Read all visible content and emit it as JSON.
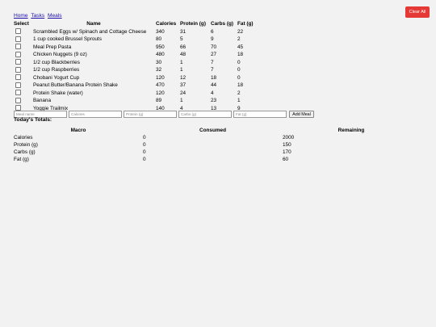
{
  "clear_all_label": "Clear All",
  "nav": {
    "home": "Home",
    "tasks": "Tasks",
    "meals": "Meals"
  },
  "meals_table": {
    "headers": {
      "select": "Select",
      "name": "Name",
      "calories": "Calories",
      "protein": "Protein (g)",
      "carbs": "Carbs (g)",
      "fat": "Fat (g)"
    },
    "rows": [
      {
        "name": "Scrambled Eggs w/ Spinach and Cottage Cheese",
        "calories": "340",
        "protein": "31",
        "carbs": "6",
        "fat": "22"
      },
      {
        "name": "1 cup cooked Brussel Sprouts",
        "calories": "80",
        "protein": "5",
        "carbs": "9",
        "fat": "2"
      },
      {
        "name": "Meal Prep Pasta",
        "calories": "950",
        "protein": "66",
        "carbs": "70",
        "fat": "45"
      },
      {
        "name": "Chicken Nuggets (9 oz)",
        "calories": "480",
        "protein": "48",
        "carbs": "27",
        "fat": "18"
      },
      {
        "name": "1/2 cup Blackberries",
        "calories": "30",
        "protein": "1",
        "carbs": "7",
        "fat": "0"
      },
      {
        "name": "1/2 cup Raspberries",
        "calories": "32",
        "protein": "1",
        "carbs": "7",
        "fat": "0"
      },
      {
        "name": "Chobani Yogurt Cup",
        "calories": "120",
        "protein": "12",
        "carbs": "18",
        "fat": "0"
      },
      {
        "name": "Peanut Butter/Banana Protein Shake",
        "calories": "470",
        "protein": "37",
        "carbs": "44",
        "fat": "18"
      },
      {
        "name": "Protein Shake (water)",
        "calories": "120",
        "protein": "24",
        "carbs": "4",
        "fat": "2"
      },
      {
        "name": "Banana",
        "calories": "89",
        "protein": "1",
        "carbs": "23",
        "fat": "1"
      },
      {
        "name": "Yoggie Trailmix",
        "calories": "140",
        "protein": "4",
        "carbs": "13",
        "fat": "9"
      }
    ]
  },
  "add_form": {
    "name_placeholder": "Meal name",
    "calories_placeholder": "Calories",
    "protein_placeholder": "Protein (g)",
    "carbs_placeholder": "Carbs (g)",
    "fat_placeholder": "Fat (g)",
    "add_label": "Add Meal"
  },
  "totals": {
    "title": "Today's Totals:",
    "headers": {
      "macro": "Macro",
      "consumed": "Consumed",
      "remaining": "Remaining"
    },
    "rows": [
      {
        "macro": "Calories",
        "consumed": "0",
        "remaining": "2000"
      },
      {
        "macro": "Protein (g)",
        "consumed": "0",
        "remaining": "150"
      },
      {
        "macro": "Carbs (g)",
        "consumed": "0",
        "remaining": "170"
      },
      {
        "macro": "Fat (g)",
        "consumed": "0",
        "remaining": "60"
      }
    ]
  },
  "colors": {
    "clear_button": "#e53935",
    "link": "#1a0dab",
    "background": "#f2f2f2"
  }
}
